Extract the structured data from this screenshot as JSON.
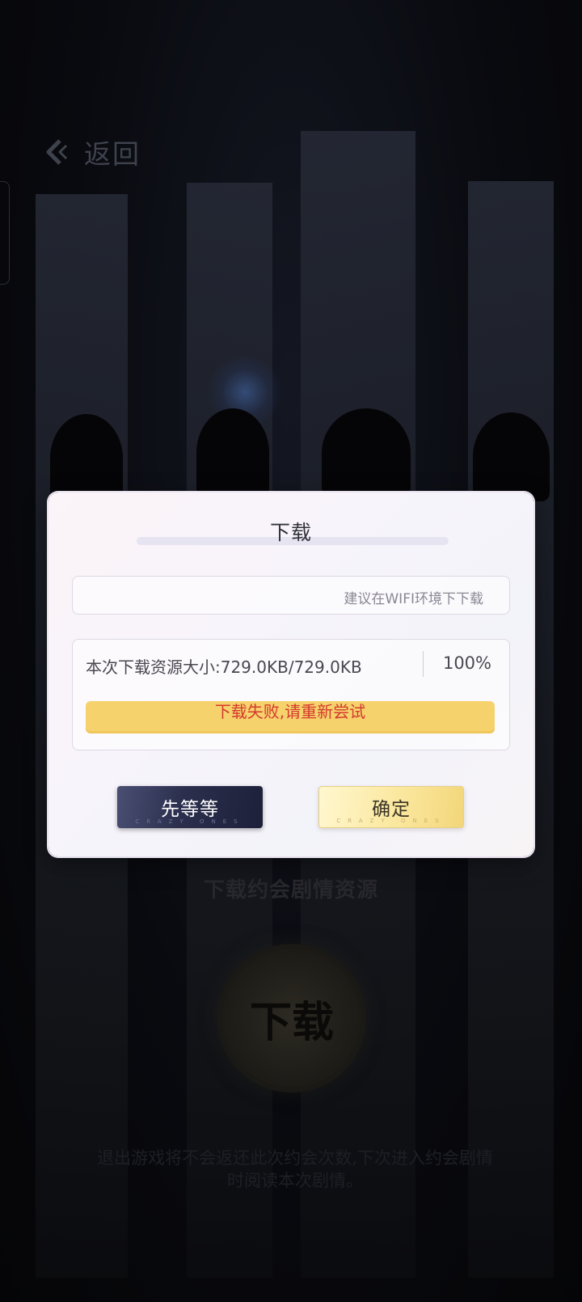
{
  "header": {
    "back_label": "返回"
  },
  "background": {
    "caption": "下载约会剧情资源",
    "circle_label": "下载",
    "note": "退出游戏将不会返还此次约会次数,下次进入约会剧情时阅读本次剧情。"
  },
  "dialog": {
    "title": "下载",
    "hint": "建议在WIFI环境下下载",
    "size_label": "本次下载资源大小:729.0KB/729.0KB",
    "progress_percent": "100%",
    "error_message": "下载失败,请重新尝试",
    "wait_button": "先等等",
    "confirm_button": "确定",
    "button_subtext": "CRAZY ONES"
  },
  "colors": {
    "error_text": "#d43a2e",
    "error_bar": "#f6d26c",
    "wait_button": "#2b2f4d",
    "confirm_button": "#fbe9a2"
  }
}
